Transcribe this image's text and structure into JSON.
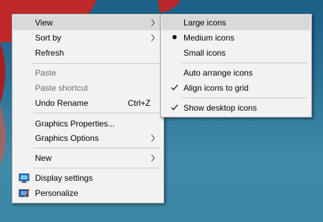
{
  "main_menu": {
    "items": [
      {
        "label": "View",
        "has_submenu": true,
        "highlighted": true
      },
      {
        "label": "Sort by",
        "has_submenu": true
      },
      {
        "label": "Refresh"
      },
      {
        "label": "Paste",
        "disabled": true
      },
      {
        "label": "Paste shortcut",
        "disabled": true
      },
      {
        "label": "Undo Rename",
        "shortcut": "Ctrl+Z"
      },
      {
        "label": "Graphics Properties..."
      },
      {
        "label": "Graphics Options",
        "has_submenu": true
      },
      {
        "label": "New",
        "has_submenu": true
      },
      {
        "label": "Display settings",
        "icon": "display-icon"
      },
      {
        "label": "Personalize",
        "icon": "personalize-icon"
      }
    ]
  },
  "view_submenu": {
    "items": [
      {
        "label": "Large icons",
        "highlighted": true
      },
      {
        "label": "Medium icons",
        "mark": "bullet"
      },
      {
        "label": "Small icons"
      },
      {
        "label": "Auto arrange icons"
      },
      {
        "label": "Align icons to grid",
        "mark": "check"
      },
      {
        "label": "Show desktop icons",
        "mark": "check"
      }
    ]
  },
  "colors": {
    "menu_bg": "#f2f2f2",
    "highlight": "#d9d9d9",
    "disabled_text": "#6d6d6d",
    "desktop": "#2a7196"
  }
}
